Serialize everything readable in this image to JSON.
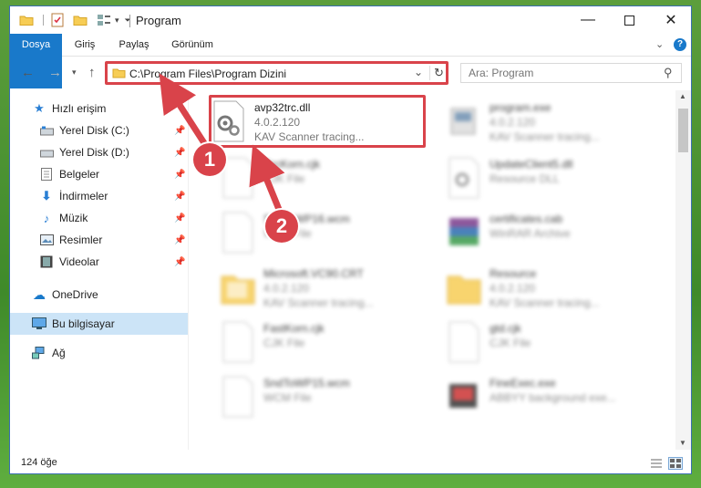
{
  "window": {
    "title": "Program"
  },
  "ribbon": {
    "tabs": [
      "Dosya",
      "Giriş",
      "Paylaş",
      "Görünüm"
    ]
  },
  "address": {
    "path": "C:\\Program Files\\Program Dizini"
  },
  "search": {
    "placeholder": "Ara: Program"
  },
  "nav": {
    "quick_access": "Hızlı erişim",
    "items": [
      {
        "label": "Yerel Disk (C:)",
        "icon": "drive-icon"
      },
      {
        "label": "Yerel Disk (D:)",
        "icon": "drive-icon"
      },
      {
        "label": "Belgeler",
        "icon": "documents-icon"
      },
      {
        "label": "İndirmeler",
        "icon": "download-icon"
      },
      {
        "label": "Müzik",
        "icon": "music-icon"
      },
      {
        "label": "Resimler",
        "icon": "pictures-icon"
      },
      {
        "label": "Videolar",
        "icon": "videos-icon"
      }
    ],
    "onedrive": "OneDrive",
    "this_pc": "Bu bilgisayar",
    "network": "Ağ"
  },
  "files": [
    {
      "name": "avp32trc.dll",
      "line1": "4.0.2.120",
      "line2": "KAV Scanner tracing...",
      "icon": "dll-icon"
    },
    {
      "name": "program.exe",
      "line1": "4.0.2.120",
      "line2": "KAV Scanner tracing...",
      "icon": "exe-icon"
    },
    {
      "name": "CrcKorn.cjk",
      "line1": "CJK File",
      "line2": "",
      "icon": "file-icon"
    },
    {
      "name": "UpdateClient5.dll",
      "line1": "Resource DLL",
      "line2": "",
      "icon": "dll-icon"
    },
    {
      "name": "SndToWP16.wcm",
      "line1": "WCM File",
      "line2": "",
      "icon": "file-icon"
    },
    {
      "name": "certificates.cab",
      "line1": "WinRAR Archive",
      "line2": "",
      "icon": "archive-icon"
    },
    {
      "name": "Microsoft.VC90.CRT",
      "line1": "4.0.2.120",
      "line2": "KAV Scanner tracing...",
      "icon": "folder-icon"
    },
    {
      "name": "Resource",
      "line1": "4.0.2.120",
      "line2": "KAV Scanner tracing...",
      "icon": "folder-icon"
    },
    {
      "name": "FastKorn.cjk",
      "line1": "CJK File",
      "line2": "",
      "icon": "file-icon"
    },
    {
      "name": "gtd.cjk",
      "line1": "CJK File",
      "line2": "",
      "icon": "file-icon"
    },
    {
      "name": "SndToWP15.wcm",
      "line1": "WCM File",
      "line2": "",
      "icon": "file-icon"
    },
    {
      "name": "FineExec.exe",
      "line1": "ABBYY background exe...",
      "line2": "",
      "icon": "exe-icon"
    }
  ],
  "status": {
    "count": "124 öğe"
  },
  "badges": [
    "1",
    "2"
  ],
  "colors": {
    "accent": "#1979ca",
    "highlight": "#d9434a",
    "selection": "#cce4f7"
  }
}
